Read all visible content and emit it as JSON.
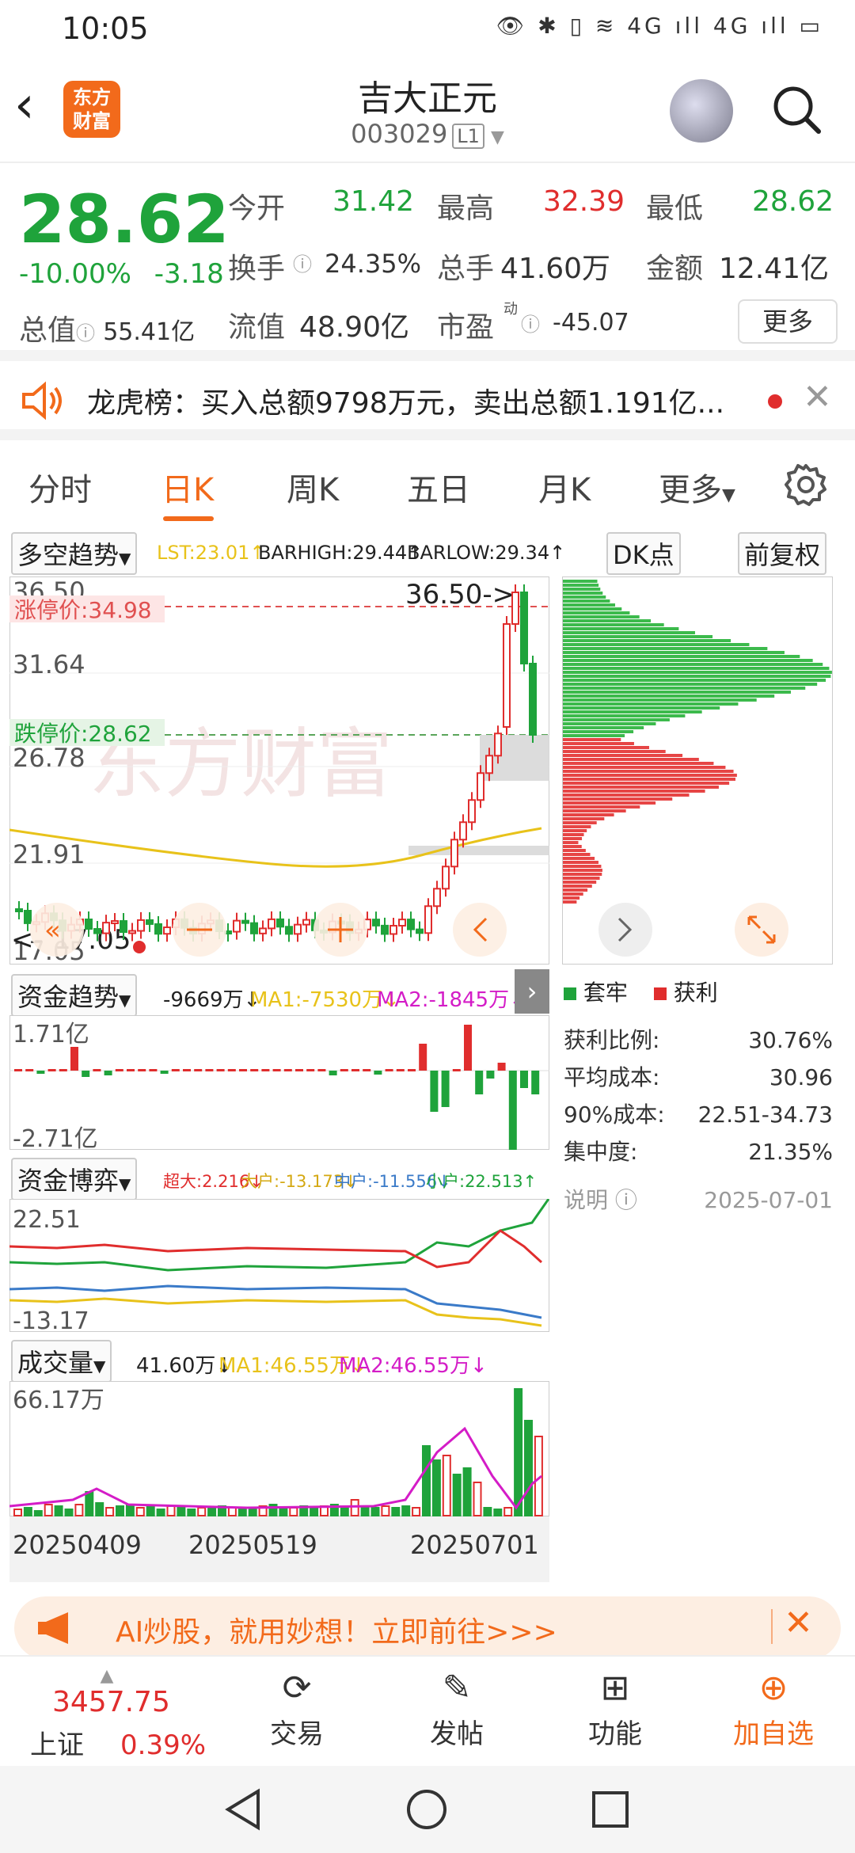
{
  "status_bar": {
    "time": "10:05",
    "icons": "👁 ✱ ▯ ≋ 4G ıll 4G ıll ▭"
  },
  "header": {
    "back": "‹",
    "logo_line1": "东方",
    "logo_line2": "财富",
    "title": "吉大正元",
    "code": "003029",
    "code_badge": "L1"
  },
  "quote": {
    "price": "28.62",
    "change_pct": "-10.00%",
    "change_abs": "-3.18",
    "open_label": "今开",
    "open": "31.42",
    "high_label": "最高",
    "high": "32.39",
    "low_label": "最低",
    "low": "28.62",
    "turnover_label": "换手",
    "turnover": "24.35%",
    "volume_label": "总手",
    "volume": "41.60万",
    "amount_label": "金额",
    "amount": "12.41亿",
    "mcap_label": "总值",
    "mcap": "55.41亿",
    "float_label": "流值",
    "float": "48.90亿",
    "pe_label": "市盈",
    "pe_sup": "动",
    "pe": "-45.07",
    "more": "更多"
  },
  "dragon": {
    "text": "龙虎榜：买入总额9798万元，卖出总额1.191亿..."
  },
  "tabs": [
    "分时",
    "日K",
    "周K",
    "五日",
    "月K",
    "更多"
  ],
  "kline": {
    "indicator": "多空趋势",
    "lst": "LST:23.01↑",
    "barhigh": "BARHIGH:29.44↑",
    "barlow": "BARLOW:29.34↑",
    "dk": "DK点",
    "fuquan": "前复权",
    "y_labels": [
      "36.50",
      "31.64",
      "26.78",
      "21.91",
      "17.05"
    ],
    "limit_up": "涨停价:34.98",
    "limit_down": "跌停价:28.62",
    "high_marker": "36.50->",
    "low_marker": "17.05",
    "watermark": "东方财富"
  },
  "chips": {
    "legend_trap": "套牢",
    "legend_profit": "获利",
    "rows": [
      {
        "k": "获利比例:",
        "v": "30.76%"
      },
      {
        "k": "平均成本:",
        "v": "30.96"
      },
      {
        "k": "90%成本:",
        "v": "22.51-34.73"
      },
      {
        "k": "集中度:",
        "v": "21.35%"
      }
    ],
    "note_label": "说明",
    "date": "2025-07-01"
  },
  "fund_trend": {
    "name": "资金趋势",
    "val": "-9669万↓",
    "ma1": "MA1:-7530万↓",
    "ma2": "MA2:-1845万↓",
    "y_top": "1.71亿",
    "y_bot": "-2.71亿"
  },
  "fund_game": {
    "name": "资金博弈",
    "super": "超大:2.216↓",
    "big": "大户:-13.173↓",
    "mid": "中户:-11.556↓",
    "small": "小户:22.513↑",
    "y_top": "22.51",
    "y_bot": "-13.17"
  },
  "vol": {
    "name": "成交量",
    "val": "41.60万↓",
    "ma1": "MA1:46.55万↓",
    "ma2": "MA2:46.55万↓",
    "y_top": "66.17万",
    "dates": [
      "20250409",
      "20250519",
      "20250701"
    ]
  },
  "ai_banner": {
    "text": "AI炒股，就用妙想！立即前往>>>"
  },
  "bottom": {
    "index_val": "3457.75",
    "index_name": "上证",
    "index_pct": "0.39%",
    "trade": "交易",
    "post": "发帖",
    "func": "功能",
    "add": "加自选"
  },
  "colors": {
    "red": "#e02d2d",
    "green": "#1fa33b",
    "orange": "#f26a1b",
    "yellow": "#e8c21a",
    "magenta": "#d41cc7"
  }
}
